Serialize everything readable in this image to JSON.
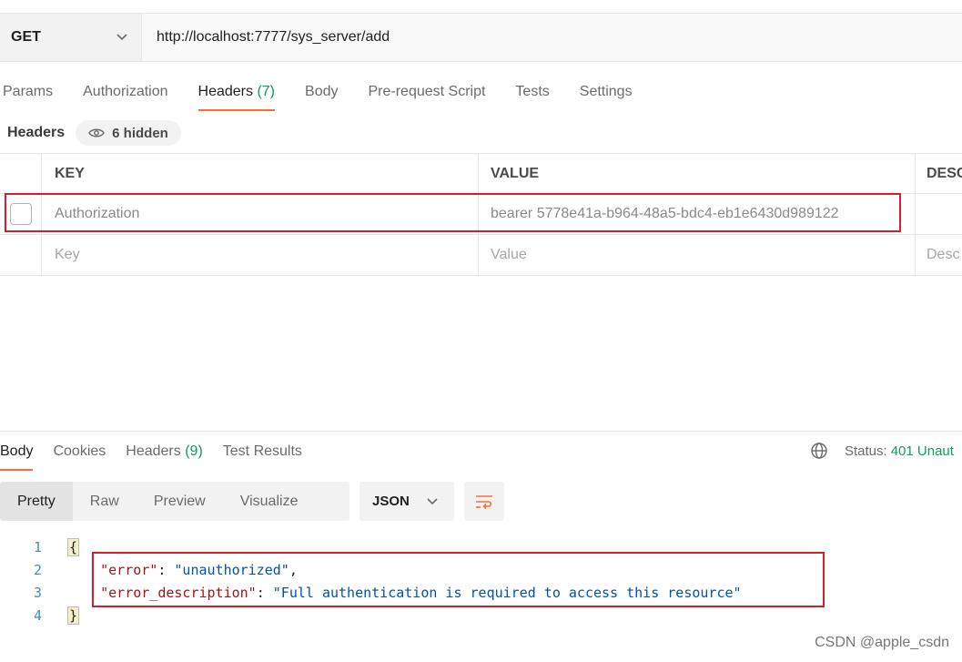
{
  "request": {
    "method": "GET",
    "url": "http://localhost:7777/sys_server/add"
  },
  "request_tabs": [
    {
      "label": "Params"
    },
    {
      "label": "Authorization"
    },
    {
      "label": "Headers",
      "count": "(7)"
    },
    {
      "label": "Body"
    },
    {
      "label": "Pre-request Script"
    },
    {
      "label": "Tests"
    },
    {
      "label": "Settings"
    }
  ],
  "headers_section": {
    "title": "Headers",
    "hidden_label": "6 hidden",
    "columns": {
      "key": "KEY",
      "value": "VALUE",
      "desc": "DESC"
    },
    "rows": [
      {
        "key": "Authorization",
        "value": "bearer 5778e41a-b964-48a5-bdc4-eb1e6430d989122",
        "desc": ""
      }
    ],
    "placeholder": {
      "key": "Key",
      "value": "Value",
      "desc": "Desc"
    }
  },
  "response_tabs": [
    {
      "label": "Body"
    },
    {
      "label": "Cookies"
    },
    {
      "label": "Headers",
      "count": "(9)"
    },
    {
      "label": "Test Results"
    }
  ],
  "status": {
    "label": "Status:",
    "code": "401 Unaut"
  },
  "view_modes": [
    "Pretty",
    "Raw",
    "Preview",
    "Visualize"
  ],
  "format": "JSON",
  "code": {
    "line_numbers": [
      "1",
      "2",
      "3",
      "4"
    ],
    "open_brace": "{",
    "close_brace": "}",
    "error_key": "\"error\"",
    "error_value": "\"unauthorized\"",
    "desc_key": "\"error_description\"",
    "desc_value": "\"Full authentication is required to access this resource\""
  },
  "watermark": "CSDN @apple_csdn",
  "colors": {
    "accent": "#ff6c37",
    "status_green": "#0f9d58",
    "highlight_red": "#d0202e"
  }
}
